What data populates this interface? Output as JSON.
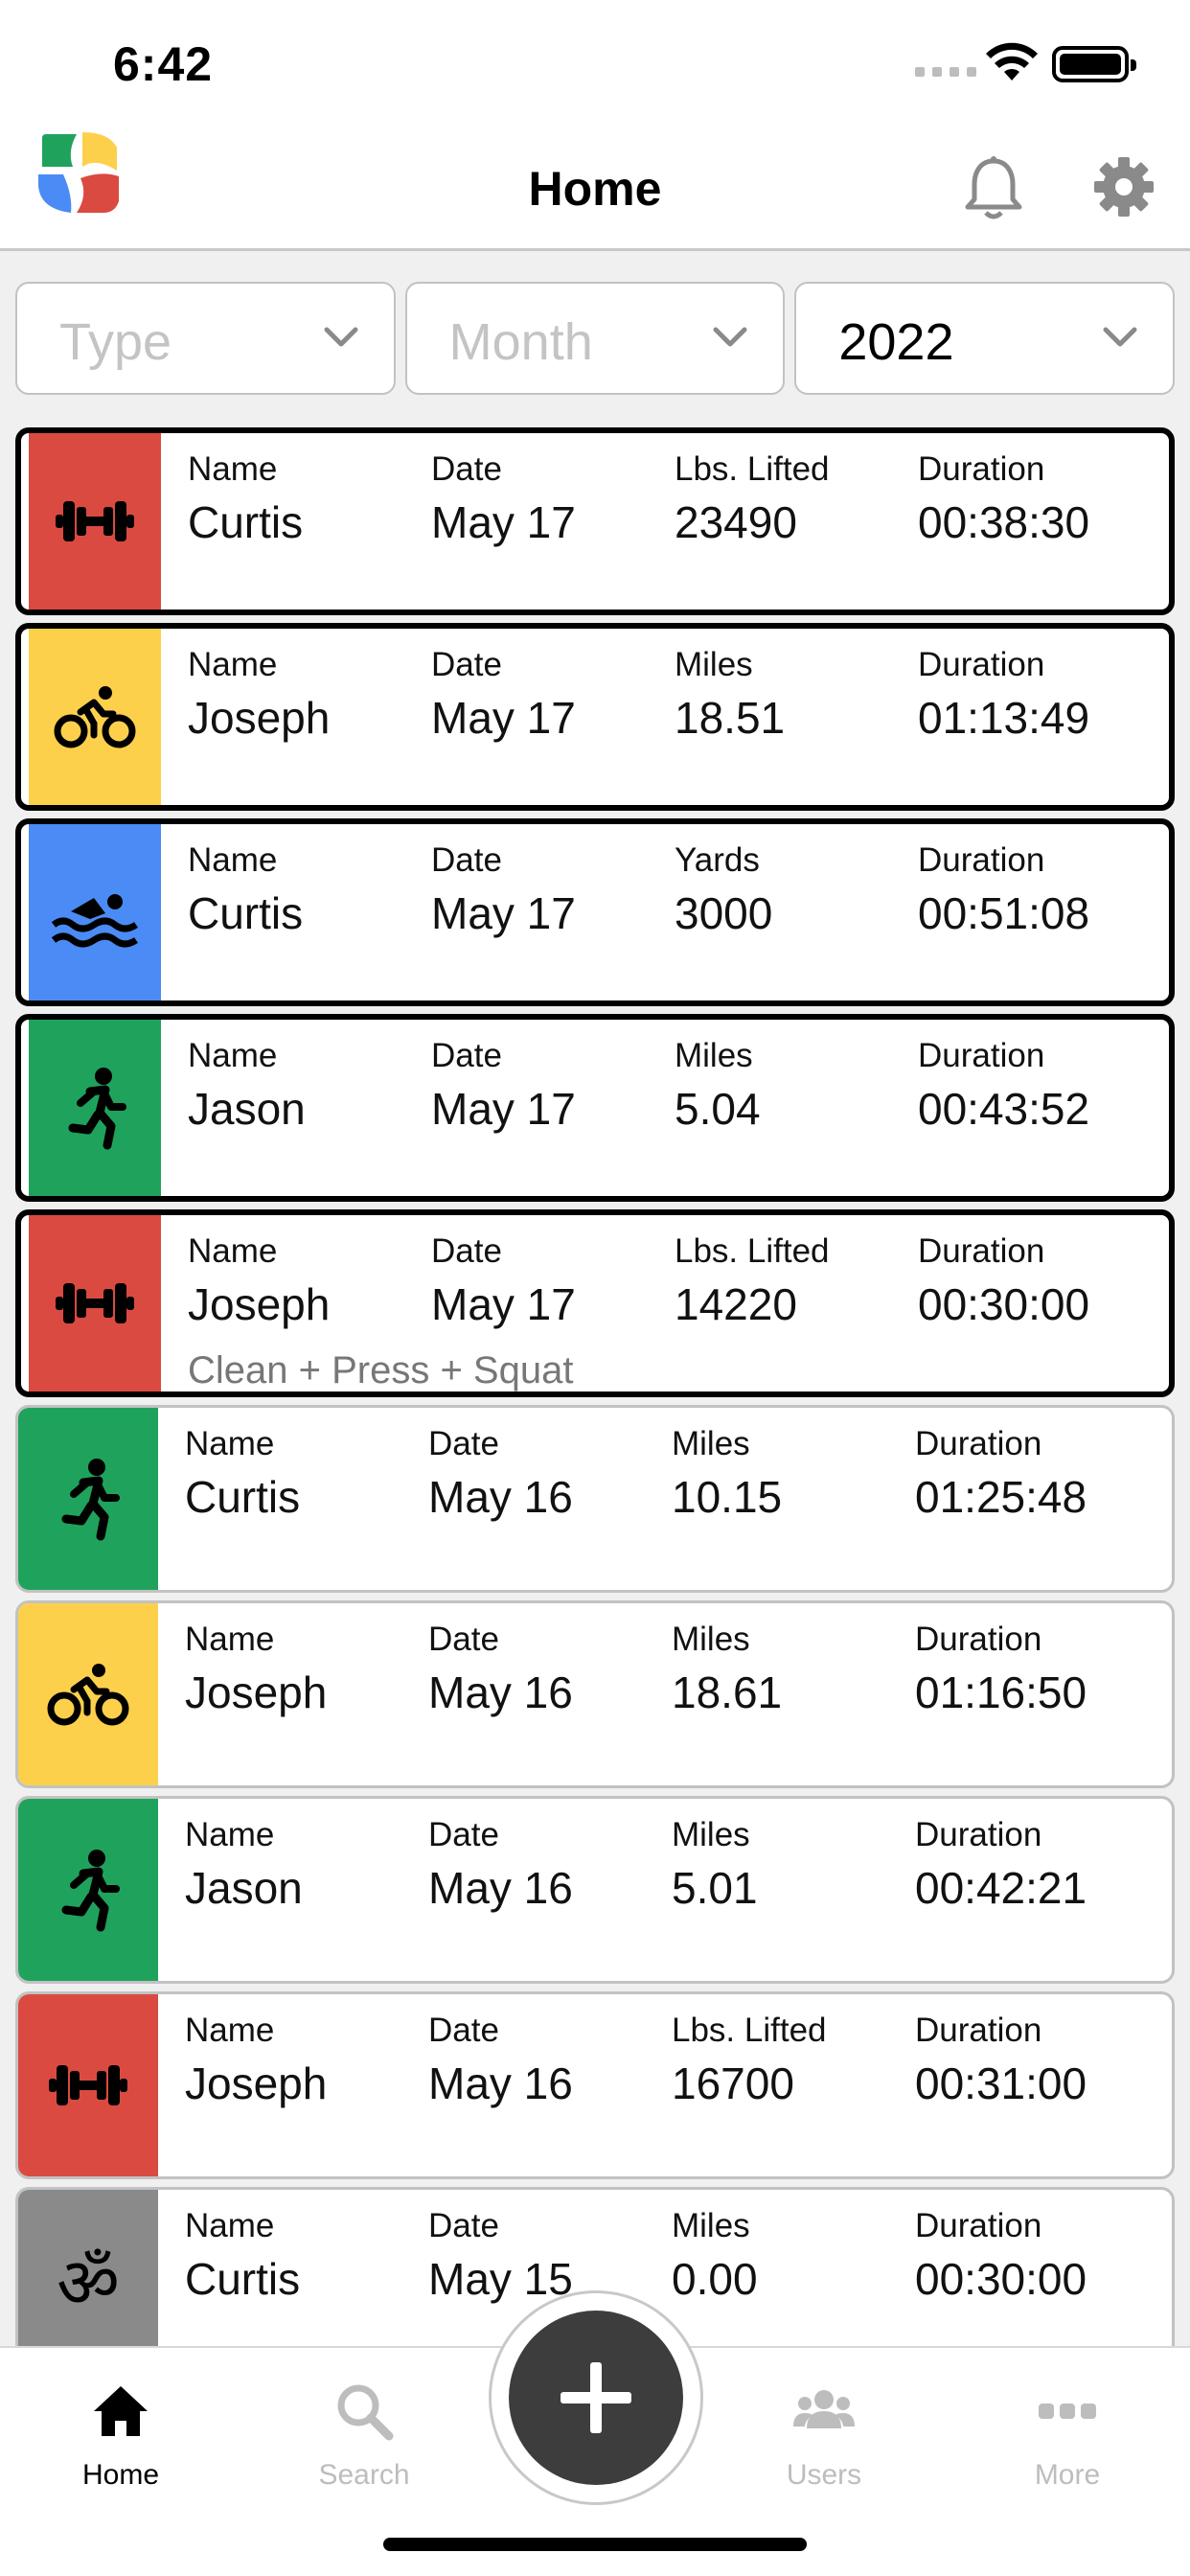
{
  "status_bar": {
    "time": "6:42"
  },
  "header": {
    "title": "Home"
  },
  "filters": [
    {
      "label": "Type",
      "selected": false
    },
    {
      "label": "Month",
      "selected": false
    },
    {
      "label": "2022",
      "selected": true
    }
  ],
  "field_labels": {
    "name": "Name",
    "date": "Date",
    "duration": "Duration"
  },
  "activities": [
    {
      "type": "weightlifting",
      "color": "#db4a40",
      "icon": "dumbbell-icon",
      "highlighted": true,
      "name": "Curtis",
      "date": "May 17",
      "metric_label": "Lbs. Lifted",
      "metric_value": "23490",
      "duration": "00:38:30",
      "note": ""
    },
    {
      "type": "cycling",
      "color": "#fdd04c",
      "icon": "bike-icon",
      "highlighted": true,
      "name": "Joseph",
      "date": "May 17",
      "metric_label": "Miles",
      "metric_value": "18.51",
      "duration": "01:13:49",
      "note": ""
    },
    {
      "type": "swimming",
      "color": "#4b8bf5",
      "icon": "swimmer-icon",
      "highlighted": true,
      "name": "Curtis",
      "date": "May 17",
      "metric_label": "Yards",
      "metric_value": "3000",
      "duration": "00:51:08",
      "note": ""
    },
    {
      "type": "running",
      "color": "#1fa35c",
      "icon": "runner-icon",
      "highlighted": true,
      "name": "Jason",
      "date": "May 17",
      "metric_label": "Miles",
      "metric_value": "5.04",
      "duration": "00:43:52",
      "note": ""
    },
    {
      "type": "weightlifting",
      "color": "#db4a40",
      "icon": "dumbbell-icon",
      "highlighted": true,
      "name": "Joseph",
      "date": "May 17",
      "metric_label": "Lbs. Lifted",
      "metric_value": "14220",
      "duration": "00:30:00",
      "note": "Clean + Press + Squat"
    },
    {
      "type": "running",
      "color": "#1fa35c",
      "icon": "runner-icon",
      "highlighted": false,
      "name": "Curtis",
      "date": "May 16",
      "metric_label": "Miles",
      "metric_value": "10.15",
      "duration": "01:25:48",
      "note": ""
    },
    {
      "type": "cycling",
      "color": "#fdd04c",
      "icon": "bike-icon",
      "highlighted": false,
      "name": "Joseph",
      "date": "May 16",
      "metric_label": "Miles",
      "metric_value": "18.61",
      "duration": "01:16:50",
      "note": ""
    },
    {
      "type": "running",
      "color": "#1fa35c",
      "icon": "runner-icon",
      "highlighted": false,
      "name": "Jason",
      "date": "May 16",
      "metric_label": "Miles",
      "metric_value": "5.01",
      "duration": "00:42:21",
      "note": ""
    },
    {
      "type": "weightlifting",
      "color": "#db4a40",
      "icon": "dumbbell-icon",
      "highlighted": false,
      "name": "Joseph",
      "date": "May 16",
      "metric_label": "Lbs. Lifted",
      "metric_value": "16700",
      "duration": "00:31:00",
      "note": ""
    },
    {
      "type": "yoga",
      "color": "#8a8a8a",
      "icon": "om-icon",
      "highlighted": false,
      "name": "Curtis",
      "date": "May 15",
      "metric_label": "Miles",
      "metric_value": "0.00",
      "duration": "00:30:00",
      "note": ""
    }
  ],
  "tabbar": {
    "home": "Home",
    "search": "Search",
    "users": "Users",
    "more": "More",
    "active": "home",
    "fab_icon": "plus-icon"
  },
  "colors": {
    "active_tab": "#000000",
    "inactive_tab": "#bdbdbd",
    "fab": "#3d3d3d"
  }
}
